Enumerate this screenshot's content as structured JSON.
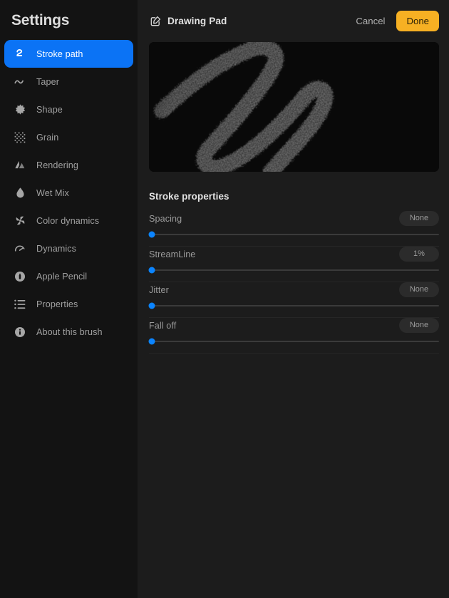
{
  "sidebar": {
    "title": "Settings",
    "items": [
      {
        "label": "Stroke path",
        "icon": "stroke-path-icon",
        "active": true
      },
      {
        "label": "Taper",
        "icon": "taper-wave-icon",
        "active": false
      },
      {
        "label": "Shape",
        "icon": "shape-burst-icon",
        "active": false
      },
      {
        "label": "Grain",
        "icon": "grain-grid-icon",
        "active": false
      },
      {
        "label": "Rendering",
        "icon": "rendering-icon",
        "active": false
      },
      {
        "label": "Wet Mix",
        "icon": "droplet-icon",
        "active": false
      },
      {
        "label": "Color dynamics",
        "icon": "color-dynamics-icon",
        "active": false
      },
      {
        "label": "Dynamics",
        "icon": "dynamics-gauge-icon",
        "active": false
      },
      {
        "label": "Apple Pencil",
        "icon": "apple-pencil-icon",
        "active": false
      },
      {
        "label": "Properties",
        "icon": "list-icon",
        "active": false
      },
      {
        "label": "About this brush",
        "icon": "info-icon",
        "active": false
      }
    ]
  },
  "topbar": {
    "pad_title": "Drawing Pad",
    "compose_icon": "compose-icon",
    "cancel_label": "Cancel",
    "done_label": "Done"
  },
  "preview": {
    "name": "brush-stroke-preview"
  },
  "properties": {
    "section_title": "Stroke properties",
    "sliders": [
      {
        "label": "Spacing",
        "value": "None",
        "percent": 1
      },
      {
        "label": "StreamLine",
        "value": "1%",
        "percent": 1
      },
      {
        "label": "Jitter",
        "value": "None",
        "percent": 1
      },
      {
        "label": "Fall off",
        "value": "None",
        "percent": 1
      }
    ]
  },
  "colors": {
    "accent_blue": "#0b73f5",
    "slider_blue": "#0b84ff",
    "done_amber": "#f6b023",
    "sidebar_bg": "#131313",
    "main_bg": "#1c1c1c",
    "pad_bg": "#090909"
  }
}
